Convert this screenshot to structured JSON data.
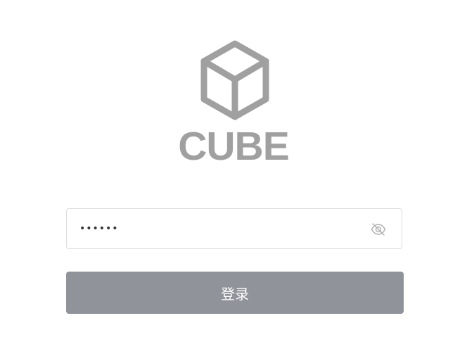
{
  "logo": {
    "icon": "cube-icon",
    "text": "CUBE",
    "color": "#a0a0a0"
  },
  "password": {
    "value": "••••••",
    "toggle_icon": "eye-off-icon"
  },
  "login_button": {
    "label": "登录",
    "background": "#909399"
  }
}
